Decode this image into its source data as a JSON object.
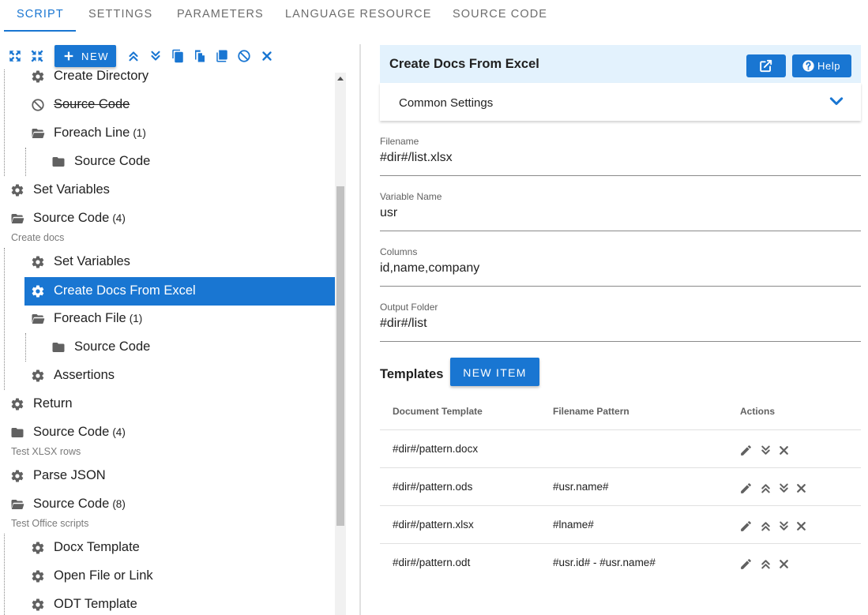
{
  "tabs": [
    {
      "label": "SCRIPT"
    },
    {
      "label": "SETTINGS"
    },
    {
      "label": "PARAMETERS"
    },
    {
      "label": "LANGUAGE RESOURCE"
    },
    {
      "label": "SOURCE CODE"
    }
  ],
  "active_tab": "SCRIPT",
  "toolbar": {
    "new_label": "NEW",
    "icons": [
      "expand-icon",
      "collapse-icon",
      "move-up-icon",
      "move-down-icon",
      "copy-icon",
      "paste-icon",
      "duplicate-icon",
      "disable-icon",
      "delete-icon"
    ]
  },
  "tree": {
    "items": [
      {
        "label": "Create Directory",
        "icon": "gear-icon"
      },
      {
        "label": "Source Code",
        "icon": "disabled-icon",
        "disabled": true
      },
      {
        "label": "Foreach Line",
        "count": "(1)",
        "icon": "folder-open-icon"
      },
      {
        "label": "Source Code",
        "icon": "folder-icon"
      },
      {
        "label": "Set Variables",
        "icon": "gear-icon"
      },
      {
        "label": "Source Code",
        "count": "(4)",
        "subtitle": "Create docs",
        "icon": "folder-open-icon"
      },
      {
        "label": "Set Variables",
        "icon": "gear-icon"
      },
      {
        "label": "Create Docs From Excel",
        "icon": "gear-icon",
        "selected": true
      },
      {
        "label": "Foreach File",
        "count": "(1)",
        "icon": "folder-open-icon"
      },
      {
        "label": "Source Code",
        "icon": "folder-icon"
      },
      {
        "label": "Assertions",
        "icon": "gear-icon"
      },
      {
        "label": "Return",
        "icon": "gear-icon"
      },
      {
        "label": "Source Code",
        "count": "(4)",
        "subtitle": "Test XLSX rows",
        "icon": "folder-icon"
      },
      {
        "label": "Parse JSON",
        "icon": "gear-icon"
      },
      {
        "label": "Source Code",
        "count": "(8)",
        "subtitle": "Test Office scripts",
        "icon": "folder-open-icon"
      },
      {
        "label": "Docx Template",
        "icon": "gear-icon"
      },
      {
        "label": "Open File or Link",
        "icon": "gear-icon"
      },
      {
        "label": "ODT Template",
        "icon": "gear-icon"
      }
    ]
  },
  "panel": {
    "title": "Create Docs From Excel",
    "help_label": "Help",
    "common_settings_label": "Common Settings",
    "fields": [
      {
        "label": "Filename",
        "value": "#dir#/list.xlsx"
      },
      {
        "label": "Variable Name",
        "value": "usr"
      },
      {
        "label": "Columns",
        "value": "id,name,company"
      },
      {
        "label": "Output Folder",
        "value": "#dir#/list"
      }
    ],
    "templates_title": "Templates",
    "new_item_label": "NEW ITEM",
    "table": {
      "headers": [
        "Document Template",
        "Filename Pattern",
        "Actions"
      ],
      "rows": [
        {
          "template": "#dir#/pattern.docx",
          "pattern": "",
          "actions": [
            "edit-icon",
            "move-down-icon",
            "delete-icon"
          ]
        },
        {
          "template": "#dir#/pattern.ods",
          "pattern": "#usr.name#",
          "actions": [
            "edit-icon",
            "move-up-icon",
            "move-down-icon",
            "delete-icon"
          ]
        },
        {
          "template": "#dir#/pattern.xlsx",
          "pattern": "#lname#",
          "actions": [
            "edit-icon",
            "move-up-icon",
            "move-down-icon",
            "delete-icon"
          ]
        },
        {
          "template": "#dir#/pattern.odt",
          "pattern": "#usr.id# - #usr.name#",
          "actions": [
            "edit-icon",
            "move-up-icon",
            "delete-icon"
          ]
        }
      ]
    }
  },
  "colors": {
    "accent": "#1976d2",
    "header_bg": "#e3f2fd",
    "icon_gray": "#616161",
    "tab_inactive": "#6d6d6d"
  }
}
